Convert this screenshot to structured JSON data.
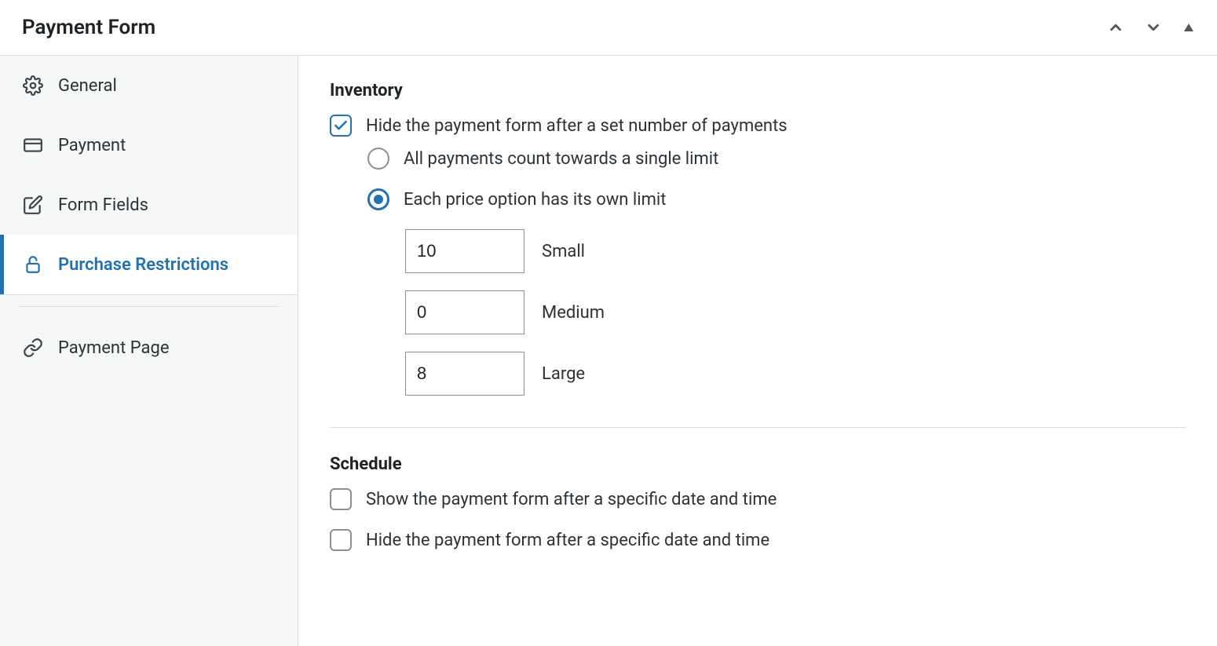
{
  "panel": {
    "title": "Payment Form"
  },
  "sidebar": {
    "items": [
      {
        "label": "General"
      },
      {
        "label": "Payment"
      },
      {
        "label": "Form Fields"
      },
      {
        "label": "Purchase Restrictions"
      },
      {
        "label": "Payment Page"
      }
    ]
  },
  "inventory": {
    "title": "Inventory",
    "hide_label": "Hide the payment form after a set number of payments",
    "radio_all": "All payments count towards a single limit",
    "radio_each": "Each price option has its own limit",
    "limits": [
      {
        "value": "10",
        "label": "Small"
      },
      {
        "value": "0",
        "label": "Medium"
      },
      {
        "value": "8",
        "label": "Large"
      }
    ]
  },
  "schedule": {
    "title": "Schedule",
    "show_after": "Show the payment form after a specific date and time",
    "hide_after": "Hide the payment form after a specific date and time"
  }
}
